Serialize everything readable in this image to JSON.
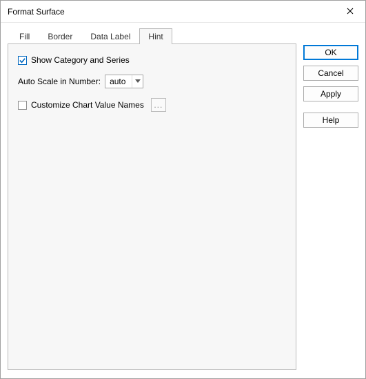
{
  "title": "Format Surface",
  "tabs": {
    "fill": "Fill",
    "border": "Border",
    "dataLabel": "Data Label",
    "hint": "Hint"
  },
  "activeTab": "hint",
  "hintPanel": {
    "showCatSeries": {
      "label": "Show Category and Series",
      "checked": true
    },
    "autoScale": {
      "label": "Auto Scale in Number:",
      "value": "auto"
    },
    "customizeNames": {
      "label": "Customize Chart Value Names",
      "checked": false
    },
    "ellipsis": "..."
  },
  "buttons": {
    "ok": "OK",
    "cancel": "Cancel",
    "apply": "Apply",
    "help": "Help"
  }
}
